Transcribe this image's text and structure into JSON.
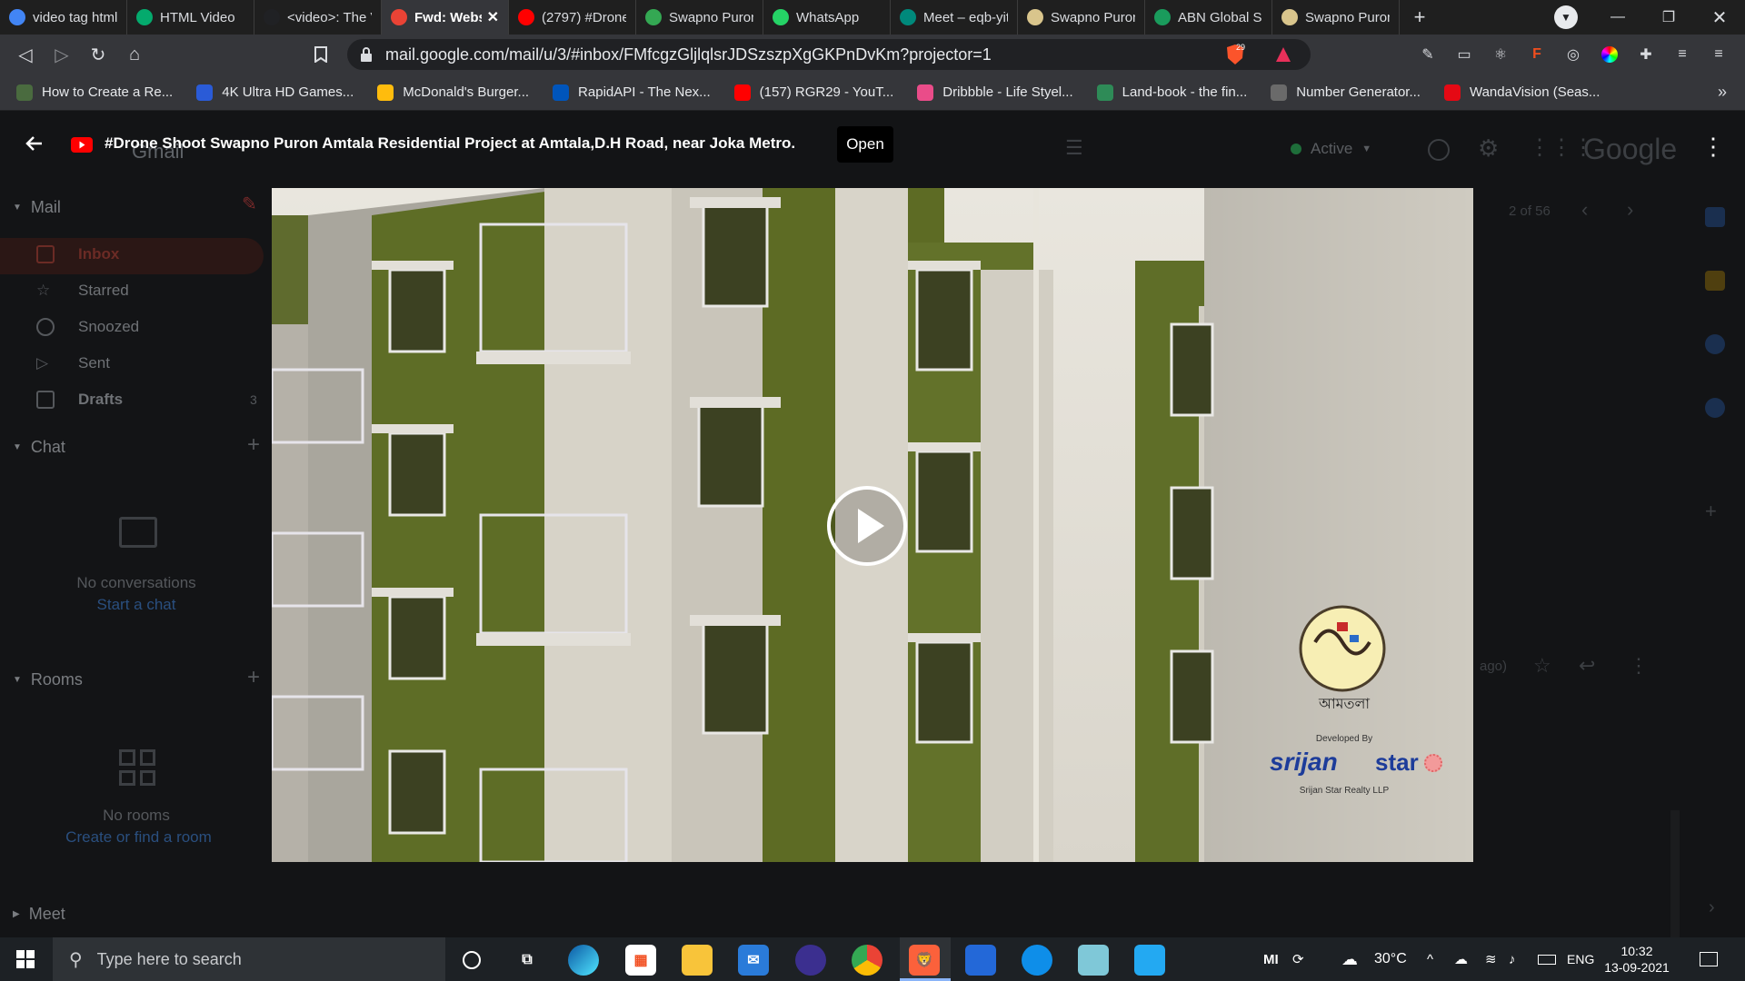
{
  "browser": {
    "tabs": [
      {
        "title": "video tag html",
        "icon": "google-icon",
        "color": "#4285f4"
      },
      {
        "title": "HTML Video",
        "icon": "w3schools-icon",
        "color": "#04aa6d"
      },
      {
        "title": "<video>: The V",
        "icon": "mdn-icon",
        "color": "#202124"
      },
      {
        "title": "Fwd: Webs",
        "icon": "gmail-icon",
        "color": "#ea4335",
        "active": true
      },
      {
        "title": "(2797) #Drone",
        "icon": "youtube-icon",
        "color": "#ff0000"
      },
      {
        "title": "Swapno Puron",
        "icon": "maps-icon",
        "color": "#34a853"
      },
      {
        "title": "WhatsApp",
        "icon": "whatsapp-icon",
        "color": "#25d366"
      },
      {
        "title": "Meet – eqb-yit",
        "icon": "meet-icon",
        "color": "#00897b"
      },
      {
        "title": "Swapno Puron",
        "icon": "site-icon",
        "color": "#d9c58c"
      },
      {
        "title": "ABN Global Sc",
        "icon": "abn-icon",
        "color": "#1a9b5c"
      },
      {
        "title": "Swapno Puron",
        "icon": "site-icon",
        "color": "#d9c58c"
      }
    ],
    "url": "mail.google.com/mail/u/3/#inbox/FMfcgzGljlqlsrJDSzszpXgGKPnDvKm?projector=1",
    "brave_count": "29",
    "bookmarks": [
      {
        "label": "How to Create a Re...",
        "color": "#4a6b3f"
      },
      {
        "label": "4K Ultra HD Games...",
        "color": "#2a5bd7"
      },
      {
        "label": "McDonald's Burger...",
        "color": "#ffbc0d"
      },
      {
        "label": "RapidAPI - The Nex...",
        "color": "#0055bb"
      },
      {
        "label": "(157) RGR29 - YouT...",
        "color": "#ff0000"
      },
      {
        "label": "Dribbble - Life Styel...",
        "color": "#ea4c89"
      },
      {
        "label": "Land-book - the fin...",
        "color": "#2e8b57"
      },
      {
        "label": "Number Generator...",
        "color": "#6a6a6a"
      },
      {
        "label": "WandaVision (Seas...",
        "color": "#e50914"
      }
    ]
  },
  "gmail": {
    "app_name": "Gmail",
    "status": "Active",
    "mail_header": "Mail",
    "items": [
      {
        "label": "Inbox"
      },
      {
        "label": "Starred"
      },
      {
        "label": "Snoozed"
      },
      {
        "label": "Sent"
      },
      {
        "label": "Drafts",
        "count": "3"
      }
    ],
    "chat_header": "Chat",
    "no_conversations": "No conversations",
    "start_chat": "Start a chat",
    "rooms_header": "Rooms",
    "no_rooms": "No rooms",
    "create_room": "Create or find a room",
    "meet_header": "Meet",
    "pagination": "2 of 56",
    "time_ago": "ago)"
  },
  "overlay": {
    "video_title": "#Drone Shoot Swapno Puron Amtala Residential Project at Amtala,D.H Road, near Joka Metro.",
    "open_label": "Open"
  },
  "video": {
    "logo_caption": "আমতলা",
    "developed_by": "Developed By",
    "brand1": "srijan",
    "brand2": "star",
    "llp": "Srijan Star Realty LLP"
  },
  "taskbar": {
    "search_placeholder": "Type here to search",
    "temperature": "30°C",
    "language": "ENG",
    "time": "10:32",
    "date": "13-09-2021"
  }
}
